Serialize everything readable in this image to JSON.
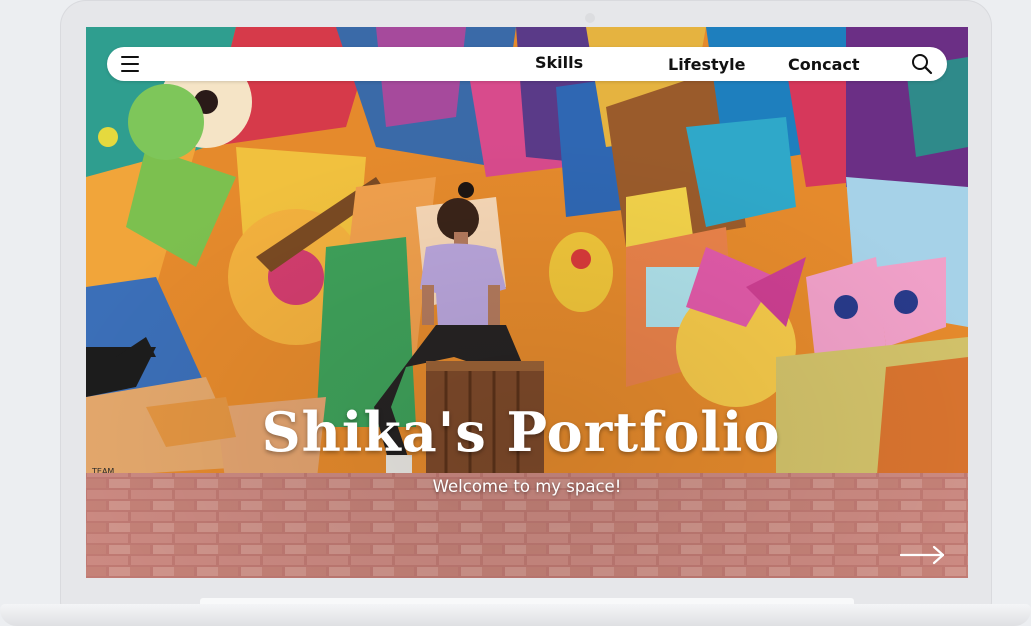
{
  "nav": {
    "links": [
      "Skills",
      "Lifestyle",
      "Concact"
    ],
    "menu_icon": "hamburger-menu-icon",
    "search_icon": "search-icon"
  },
  "hero": {
    "title": "Shika's Portfolio",
    "subtitle": "Welcome to my space!",
    "next_icon": "right-arrow-icon"
  },
  "mural": {
    "signature": "TEAM"
  },
  "colors": {
    "nav_background": "#ffffff",
    "nav_text": "#111111",
    "hero_text": "#ffffff",
    "device_frame": "#e6e7ea",
    "page_background": "#eceef1"
  }
}
